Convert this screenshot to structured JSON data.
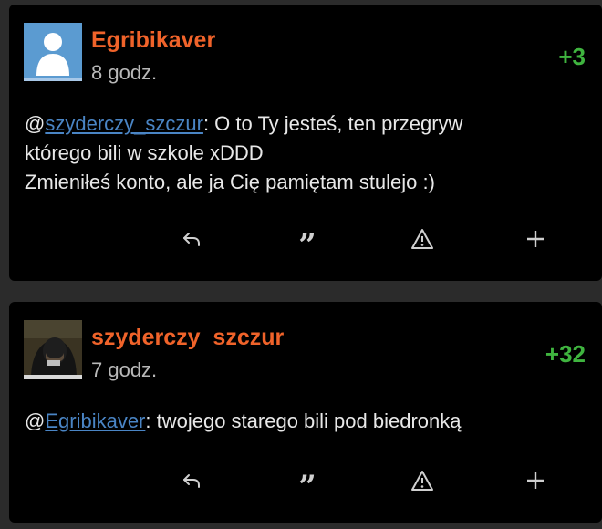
{
  "comments": [
    {
      "username": "Egribikaver",
      "time": "8 godz.",
      "score": "+3",
      "mention_prefix": "@",
      "mention": "szyderczy_szczur",
      "mention_suffix": ": O to Ty jesteś, ten przegryw",
      "lines": [
        "którego bili w szkole xDDD",
        "Zmieniłeś konto, ale ja Cię pamiętam stulejo :)"
      ],
      "avatar": "default-user-avatar"
    },
    {
      "username": "szyderczy_szczur",
      "time": "7 godz.",
      "score": "+32",
      "mention_prefix": "@",
      "mention": "Egribikaver",
      "mention_suffix": ": twojego starego bili pod biedronką",
      "avatar": "photo-avatar"
    }
  ],
  "actions": {
    "reply_icon": "reply-arrow-icon",
    "quote_icon": "quote-icon",
    "report_icon": "warning-triangle-icon",
    "plus_icon": "plus-icon",
    "quote_glyph": "”"
  },
  "colors": {
    "username": "#f0632a",
    "score": "#3fb43f",
    "mention_link": "#4a85c5",
    "card_background": "#000000",
    "page_background": "#2b2b2b"
  }
}
